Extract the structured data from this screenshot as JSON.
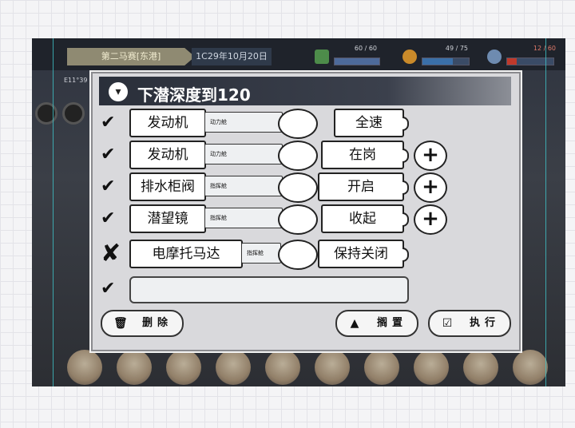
{
  "hud": {
    "location": "第二马赛[东港]",
    "date": "1C29年10月20日",
    "resources": [
      {
        "icon": "green-crate-icon",
        "label": "60 / 60",
        "fraction": 1.0,
        "color": "#4d8c4a"
      },
      {
        "icon": "fuel-bag-icon",
        "label": "49 / 75",
        "fraction": 0.65,
        "color": "#3a6fa8"
      },
      {
        "icon": "gear-parts-icon",
        "label": "12 / 60",
        "fraction": 0.2,
        "color": "#c0392b"
      }
    ],
    "side_label": "E11°39"
  },
  "panel": {
    "title": "下潜深度到120",
    "title_icon": "cup-icon",
    "rows": [
      {
        "status": "check",
        "name": "发动机",
        "tag": "动力舱",
        "state": "全速",
        "plus": false
      },
      {
        "status": "check",
        "name": "发动机",
        "tag": "动力舱",
        "state": "在岗",
        "plus": true
      },
      {
        "status": "check",
        "name": "排水柜阀",
        "tag": "指挥舱",
        "state": "开启",
        "plus": true
      },
      {
        "status": "check",
        "name": "潜望镜",
        "tag": "指挥舱",
        "state": "收起",
        "plus": true
      },
      {
        "status": "cross",
        "name": "电摩托马达",
        "tag": "指挥舱",
        "state": "保持关闭",
        "plus": false
      },
      {
        "status": "check",
        "name": "",
        "tag": "",
        "state": "",
        "plus": false
      }
    ],
    "check_glyph": "✔",
    "cross_glyph": "✘",
    "plus_glyph": "+",
    "buttons": {
      "delete": {
        "label": "删除",
        "icon": "trash-icon"
      },
      "shelve": {
        "label": "搁置",
        "icon": "triangle-up-icon"
      },
      "execute": {
        "label": "执行",
        "icon": "checkbox-icon"
      }
    }
  }
}
